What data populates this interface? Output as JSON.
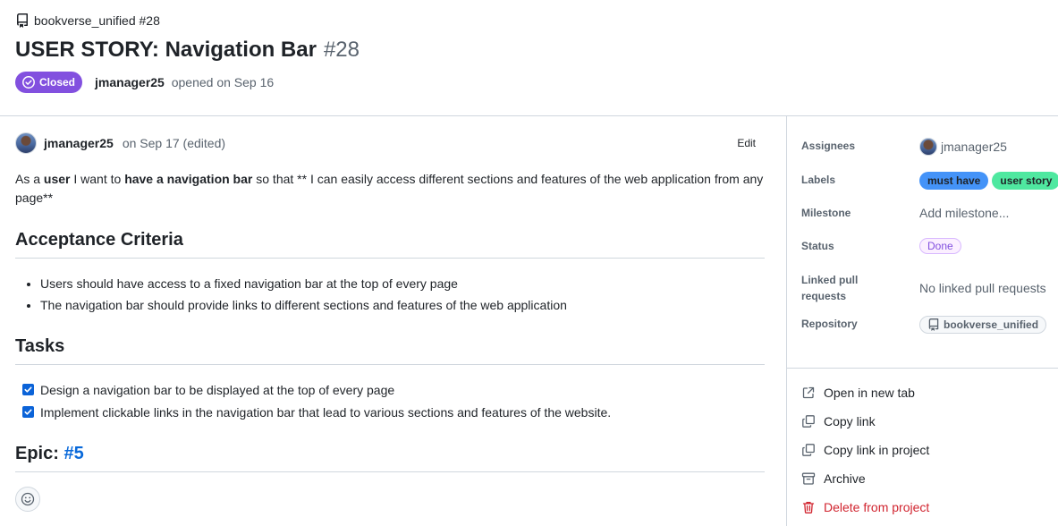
{
  "header": {
    "repo_ref": "bookverse_unified #28",
    "title": "USER STORY: Navigation Bar",
    "number": "#28",
    "state": "Closed",
    "author": "jmanager25",
    "opened_text": "opened on Sep 16"
  },
  "comment": {
    "author": "jmanager25",
    "date": "on Sep 17 (edited)",
    "edit_label": "Edit",
    "intro": {
      "p1": "As a ",
      "b1": "user",
      "p2": " I want to ",
      "b2": "have a navigation bar",
      "p3": " so that ** I can easily access different sections and features of the web application from any page**"
    },
    "acceptance_heading": "Acceptance Criteria",
    "acceptance_items": [
      "Users should have access to a fixed navigation bar at the top of every page",
      "The navigation bar should provide links to different sections and features of the web application"
    ],
    "tasks_heading": "Tasks",
    "tasks": [
      {
        "label": "Design a navigation bar to be displayed at the top of every page",
        "checked": true
      },
      {
        "label": "Implement clickable links in the navigation bar that lead to various sections and features of the website.",
        "checked": true
      }
    ],
    "epic_heading": "Epic:",
    "epic_link": "#5"
  },
  "sidebar": {
    "assignees_label": "Assignees",
    "assignee": "jmanager25",
    "labels_label": "Labels",
    "labels": [
      {
        "name": "must have",
        "color": "#4493f8"
      },
      {
        "name": "user story",
        "color": "#4fe8a0"
      }
    ],
    "milestone_label": "Milestone",
    "milestone_value": "Add milestone...",
    "status_label": "Status",
    "status_value": "Done",
    "linked_label": "Linked pull requests",
    "linked_value": "No linked pull requests",
    "repository_label": "Repository",
    "repository_value": "bookverse_unified",
    "actions": {
      "open_new_tab": "Open in new tab",
      "copy_link": "Copy link",
      "copy_link_project": "Copy link in project",
      "archive": "Archive",
      "delete": "Delete from project"
    }
  },
  "colors": {
    "closed_badge": "#8250df",
    "link": "#0969da",
    "danger": "#d1242f"
  }
}
